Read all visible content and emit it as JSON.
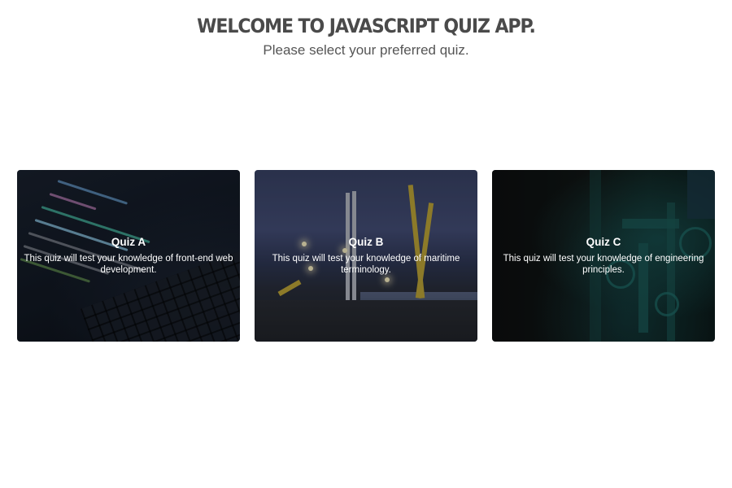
{
  "header": {
    "title": "WELCOME TO JAVASCRIPT QUIZ APP.",
    "subtitle": "Please select your preferred quiz."
  },
  "quizzes": [
    {
      "name": "Quiz A",
      "description": "This quiz will test your knowledge of front-end web development."
    },
    {
      "name": "Quiz B",
      "description": "This quiz will test your knowledge of maritime terminology."
    },
    {
      "name": "Quiz C",
      "description": "This quiz will test your knowledge of engineering principles."
    }
  ]
}
